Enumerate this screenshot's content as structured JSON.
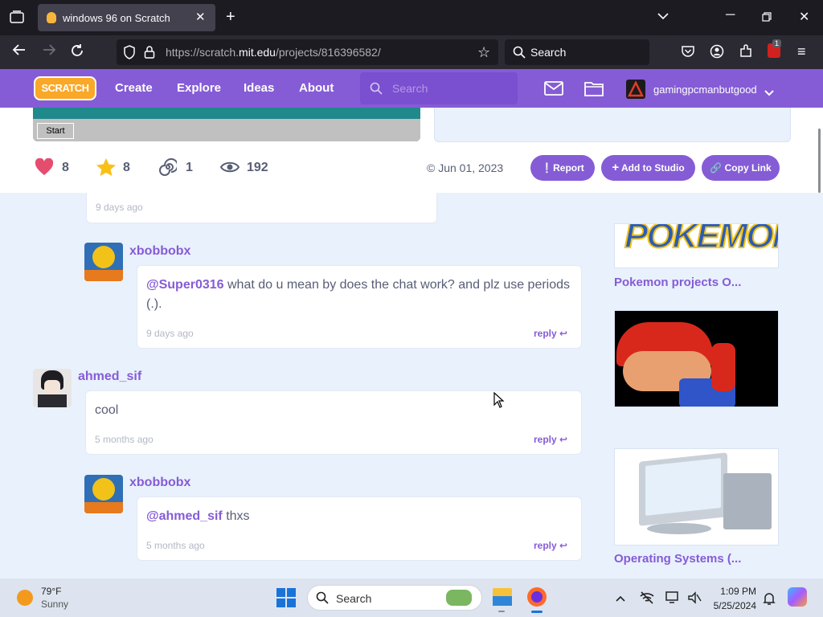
{
  "browser": {
    "tab_title": "windows 96 on Scratch",
    "url_prefix": "https://scratch.",
    "url_domain": "mit.edu",
    "url_path": "/projects/816396582/",
    "search_placeholder": "Search",
    "extension_badge": "1"
  },
  "scratch_nav": {
    "logo": "SCRATCH",
    "links": [
      "Create",
      "Explore",
      "Ideas",
      "About"
    ],
    "search_placeholder": "Search",
    "username": "gamingpcmanbutgood"
  },
  "project": {
    "start_label": "Start",
    "loves": "8",
    "favorites": "8",
    "remixes": "1",
    "views": "192",
    "date": "© Jun 01, 2023",
    "report_label": "Report",
    "add_studio_label": "Add to Studio",
    "copy_link_label": "Copy Link"
  },
  "comments": {
    "partial_time": "9 days ago",
    "items": [
      {
        "author": "xbobbobx",
        "mention": "@Super0316",
        "text": " what do u mean by does the chat work? and plz use periods (.).",
        "time": "9 days ago",
        "reply": "reply"
      },
      {
        "author": "ahmed_sif",
        "mention": "",
        "text": "cool",
        "time": "5 months ago",
        "reply": "reply"
      },
      {
        "author": "xbobbobx",
        "mention": "@ahmed_sif",
        "text": " thxs",
        "time": "5 months ago",
        "reply": "reply"
      }
    ]
  },
  "sidebar": {
    "studios": [
      {
        "title": "Pokemon projects O...",
        "thumb_text": "POKEMON"
      },
      {
        "title": ""
      },
      {
        "title": "Operating Systems (..."
      }
    ]
  },
  "taskbar": {
    "weather_temp": "79°F",
    "weather_cond": "Sunny",
    "search_label": "Search",
    "time": "1:09 PM",
    "date": "5/25/2024"
  },
  "colors": {
    "scratch_purple": "#855cd6",
    "love_red": "#e54d6f",
    "favorite_yellow": "#f9c01a"
  }
}
